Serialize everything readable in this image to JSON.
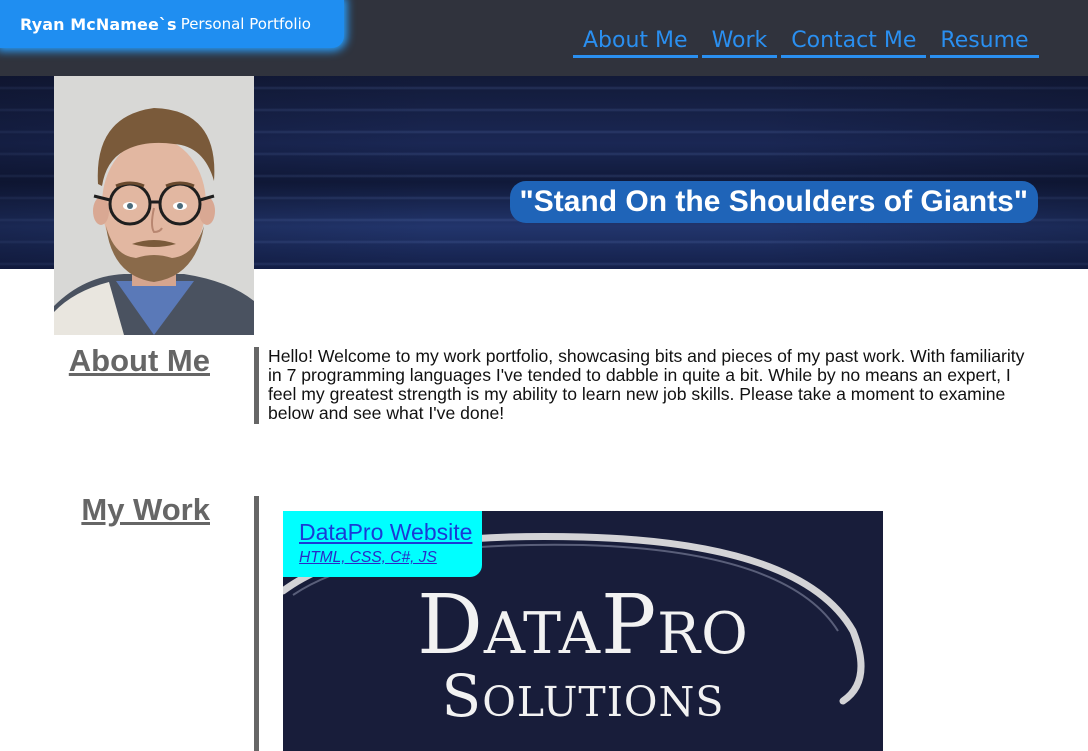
{
  "header": {
    "brand_name": "Ryan McNamee`s",
    "brand_sub": "Personal Portfolio",
    "nav": [
      "About Me",
      "Work",
      "Contact Me",
      "Resume"
    ]
  },
  "hero": {
    "quote": "\"Stand On the Shoulders of Giants\""
  },
  "about": {
    "title": "About Me",
    "text": "Hello! Welcome to my work portfolio, showcasing bits and pieces of my past work. With familiarity in 7 programming languages I've tended to dabble in quite a bit. While by no means an expert, I feel my greatest strength is my ability to learn new job skills. Please take a moment to examine below and see what I've done!"
  },
  "work": {
    "title": "My Work",
    "items": [
      {
        "name": "DataPro Website",
        "tech": "HTML, CSS, C#, JS",
        "logo_line1": "DataPro",
        "logo_line2": "Solutions"
      }
    ]
  },
  "colors": {
    "header_bg": "#30333d",
    "brand_bg": "#1f8ef1",
    "nav_link": "#2a8ff0",
    "quote_bg": "#1f64b8",
    "section_title": "#666666",
    "work_label_bg": "#00ffff"
  }
}
